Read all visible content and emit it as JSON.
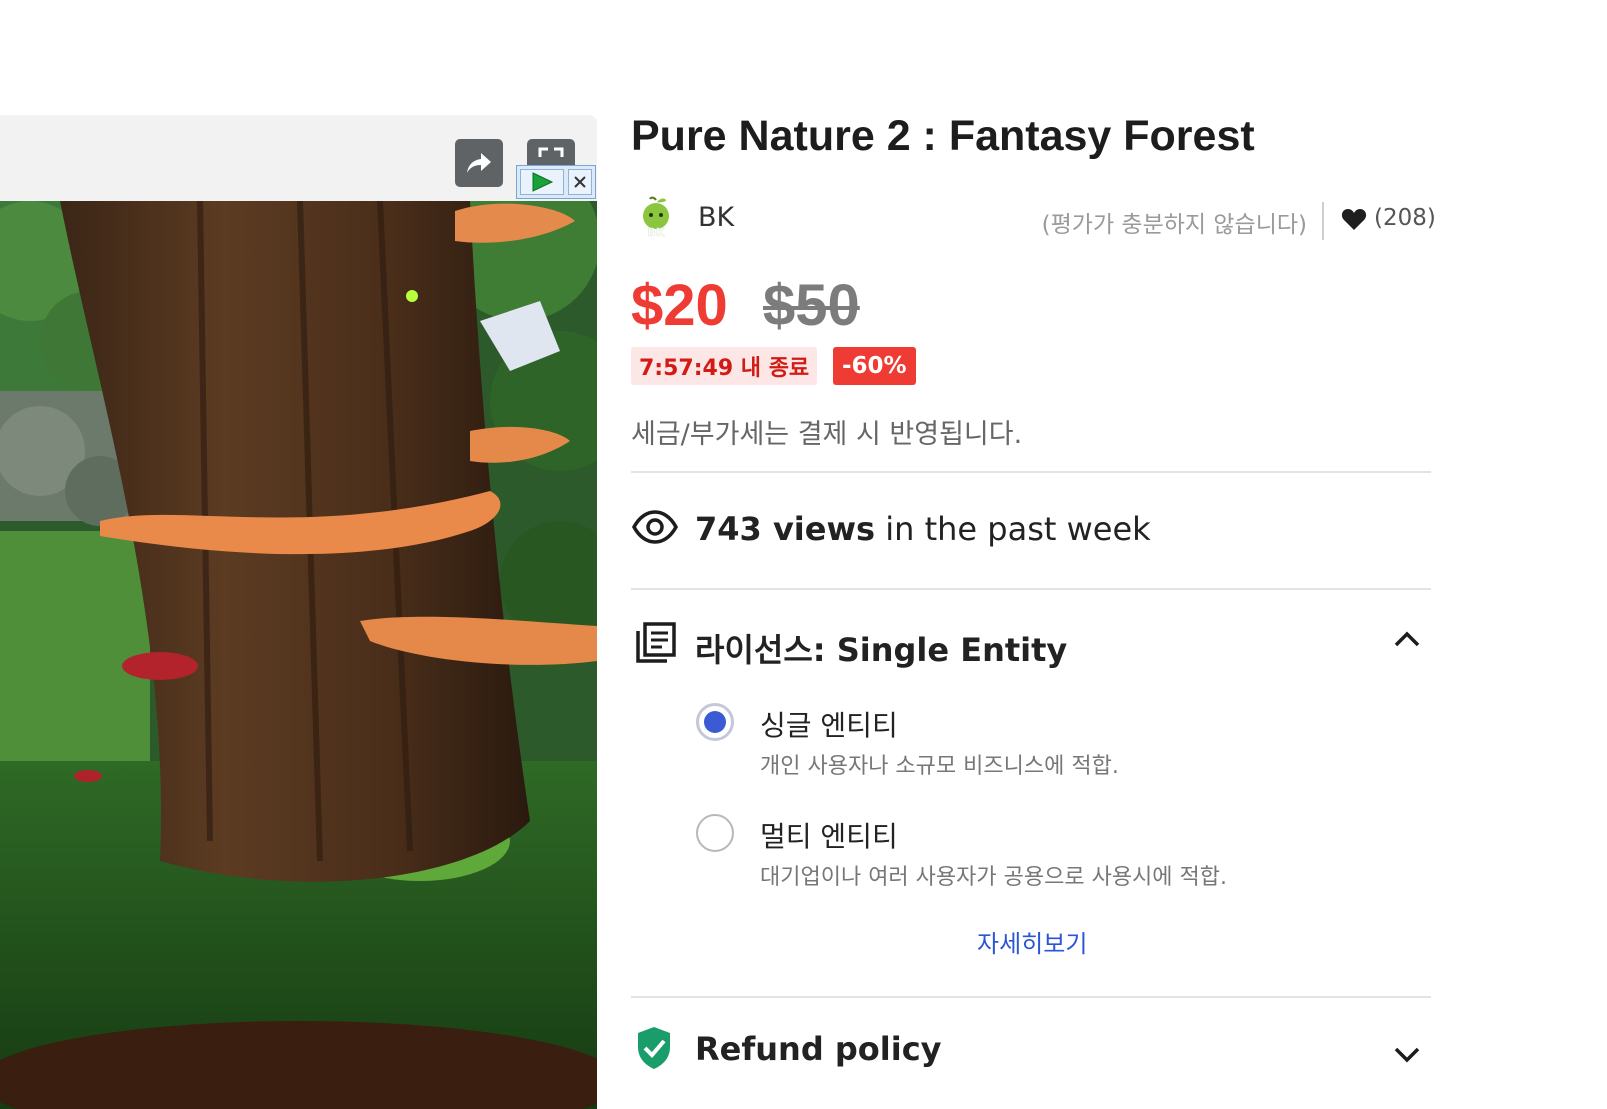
{
  "product": {
    "title": "Pure Nature 2 : Fantasy Forest",
    "publisher": "BK",
    "publisher_logo_text": "BK",
    "rating_note": "(평가가 충분하지 않습니다)",
    "favorites": "(208)",
    "price_sale": "$20",
    "price_original": "$50",
    "countdown": "7:57:49 내 종료",
    "discount": "-60%",
    "tax_note": "세금/부가세는 결제 시 반영됩니다."
  },
  "views": {
    "count": "743 views",
    "suffix": "in the past week"
  },
  "license": {
    "heading": "라이선스: Single Entity",
    "options": [
      {
        "title": "싱글 엔티티",
        "desc": "개인 사용자나 소규모 비즈니스에 적합.",
        "selected": true
      },
      {
        "title": "멀티 엔티티",
        "desc": "대기업이나 여러 사용자가 공용으로 사용시에 적합.",
        "selected": false
      }
    ],
    "more_link": "자세히보기"
  },
  "refund": {
    "heading": "Refund policy"
  },
  "icons": {
    "share": "share-icon",
    "fullscreen": "fullscreen-icon",
    "play": "play-icon",
    "close": "close-icon",
    "heart": "heart-icon",
    "eye": "eye-icon",
    "license": "license-document-icon",
    "shield": "shield-check-icon",
    "chevron_up": "chevron-up-icon",
    "chevron_down": "chevron-down-icon"
  },
  "colors": {
    "sale_red": "#ee3b33",
    "countdown_bg": "#fde7e6",
    "radio_selected": "#3a5bd4",
    "link_blue": "#2a56d6",
    "shield_green": "#1a9d6b"
  }
}
